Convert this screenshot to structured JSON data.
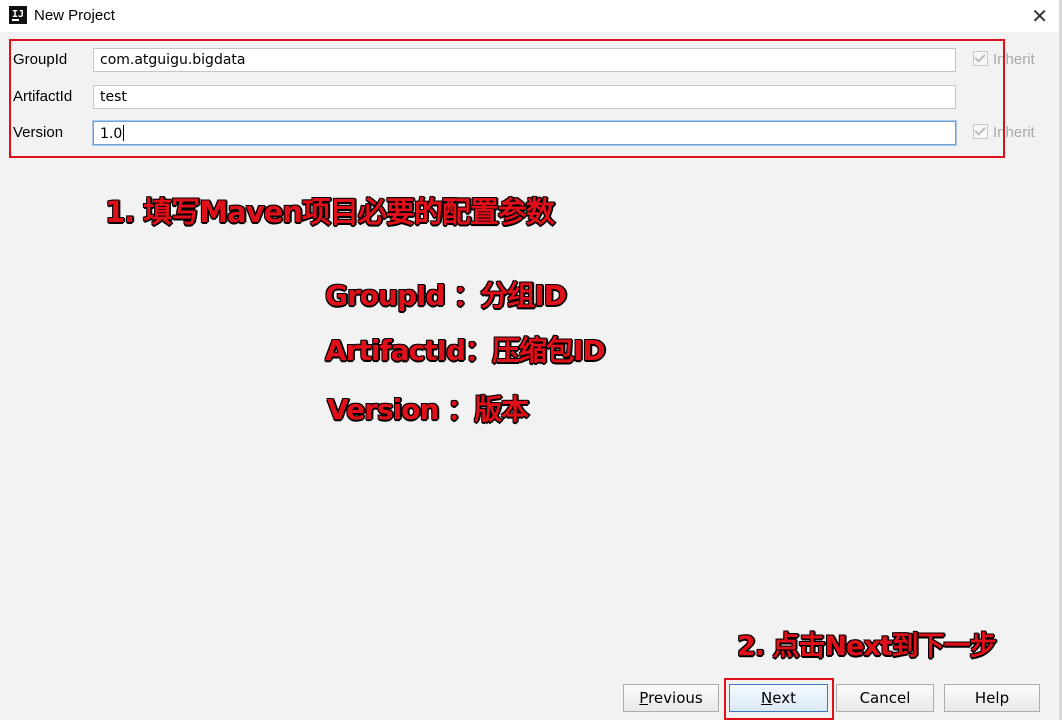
{
  "window": {
    "title": "New Project",
    "app_icon": "intellij-idea-icon",
    "close_glyph": "✕"
  },
  "form": {
    "groupId": {
      "label": "GroupId",
      "value": "com.atguigu.bigdata",
      "inherit_label": "Inherit",
      "inherit_checked": true
    },
    "artifactId": {
      "label": "ArtifactId",
      "value": "test"
    },
    "version": {
      "label": "Version",
      "value": "1.0",
      "inherit_label": "Inherit",
      "inherit_checked": true
    }
  },
  "annotations": {
    "step1": "1. 填写Maven项目必要的配置参数",
    "groupid_desc": "GroupId ：分组ID",
    "artifactid_desc": "ArtifactId：压缩包ID",
    "version_desc": "Version ：版本",
    "step2": "2. 点击Next到下一步"
  },
  "buttons": {
    "previous": {
      "mnemonic": "P",
      "rest": "revious"
    },
    "next": {
      "mnemonic": "N",
      "rest": "ext"
    },
    "cancel": "Cancel",
    "help": "Help"
  },
  "colors": {
    "annotation_red": "#e0101a",
    "focus_blue": "#6aa2d6"
  }
}
